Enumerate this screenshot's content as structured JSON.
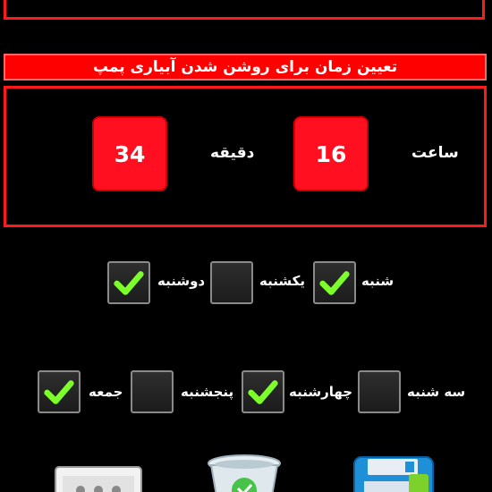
{
  "header": {
    "title": "تعیین زمان برای روشن شدن آبیاری پمپ"
  },
  "time": {
    "hour_label": "ساعت",
    "hour_value": "16",
    "minute_label": "دقیقه",
    "minute_value": "34"
  },
  "days_row1": [
    {
      "label": "شنبه",
      "checked": true
    },
    {
      "label": "یکشنبه",
      "checked": false
    },
    {
      "label": "دوشنبه",
      "checked": true
    }
  ],
  "days_row2": [
    {
      "label": "سه شنبه",
      "checked": false
    },
    {
      "label": "چهارشنبه",
      "checked": true
    },
    {
      "label": "پنجشنبه",
      "checked": false
    },
    {
      "label": "جمعه",
      "checked": true
    }
  ],
  "colors": {
    "accent": "#ff0000",
    "check": "#7cff2a"
  },
  "toolbar": {
    "icons": [
      "save-icon",
      "recycle-bin-icon",
      "device-icon"
    ]
  }
}
